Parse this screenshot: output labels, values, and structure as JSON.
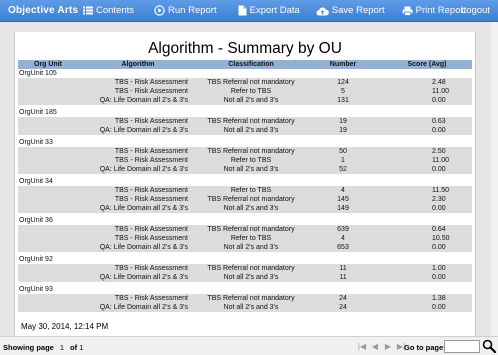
{
  "topbar": {
    "brand": "Objective Arts",
    "contents": "Contents",
    "run_report": "Run Report",
    "export_data": "Export Data",
    "save_report": "Save Report",
    "print_report": "Print Report",
    "logout": "Logout"
  },
  "report": {
    "title": "Algorithm - Summary by OU",
    "columns": [
      "Org Unit",
      "Algorithm",
      "Classification",
      "Number",
      "Score (Avg)"
    ],
    "groups": [
      {
        "org": "OrgUnit 105",
        "rows": [
          {
            "alg": "TBS - Risk Assessment",
            "cls": "TBS Referral not mandatory",
            "num": "124",
            "score": "2.48"
          },
          {
            "alg": "TBS - Risk Assessment",
            "cls": "Refer to TBS",
            "num": "5",
            "score": "11.00"
          },
          {
            "alg": "QA: Life Domain all 2's & 3's",
            "cls": "Not all 2's and 3's",
            "num": "131",
            "score": "0.00"
          }
        ]
      },
      {
        "org": "OrgUnit 185",
        "rows": [
          {
            "alg": "TBS - Risk Assessment",
            "cls": "TBS Referral not mandatory",
            "num": "19",
            "score": "0.63"
          },
          {
            "alg": "QA: Life Domain all 2's & 3's",
            "cls": "Not all 2's and 3's",
            "num": "19",
            "score": "0.00"
          }
        ]
      },
      {
        "org": "OrgUnit 33",
        "rows": [
          {
            "alg": "TBS - Risk Assessment",
            "cls": "TBS Referral not mandatory",
            "num": "50",
            "score": "2.50"
          },
          {
            "alg": "TBS - Risk Assessment",
            "cls": "Refer to TBS",
            "num": "1",
            "score": "11.00"
          },
          {
            "alg": "QA: Life Domain all 2's & 3's",
            "cls": "Not all 2's and 3's",
            "num": "52",
            "score": "0.00"
          }
        ]
      },
      {
        "org": "OrgUnit 34",
        "rows": [
          {
            "alg": "TBS - Risk Assessment",
            "cls": "Refer to TBS",
            "num": "4",
            "score": "11.50"
          },
          {
            "alg": "TBS - Risk Assessment",
            "cls": "TBS Referral not mandatory",
            "num": "145",
            "score": "2.30"
          },
          {
            "alg": "QA: Life Domain all 2's & 3's",
            "cls": "Not all 2's and 3's",
            "num": "149",
            "score": "0.00"
          }
        ]
      },
      {
        "org": "OrgUnit 36",
        "rows": [
          {
            "alg": "TBS - Risk Assessment",
            "cls": "TBS Referral not mandatory",
            "num": "639",
            "score": "0.64"
          },
          {
            "alg": "TBS - Risk Assessment",
            "cls": "Refer to TBS",
            "num": "4",
            "score": "10.50"
          },
          {
            "alg": "QA: Life Domain all 2's & 3's",
            "cls": "Not all 2's and 3's",
            "num": "653",
            "score": "0.00"
          }
        ]
      },
      {
        "org": "OrgUnit 92",
        "rows": [
          {
            "alg": "TBS - Risk Assessment",
            "cls": "TBS Referral not mandatory",
            "num": "11",
            "score": "1.00"
          },
          {
            "alg": "QA: Life Domain all 2's & 3's",
            "cls": "Not all 2's and 3's",
            "num": "11",
            "score": "0.00"
          }
        ]
      },
      {
        "org": "OrgUnit 93",
        "rows": [
          {
            "alg": "TBS - Risk Assessment",
            "cls": "TBS Referral not mandatory",
            "num": "24",
            "score": "1.38"
          },
          {
            "alg": "QA: Life Domain all 2's & 3's",
            "cls": "Not all 2's and 3's",
            "num": "24",
            "score": "0.00"
          }
        ]
      }
    ],
    "timestamp": "May 30, 2014, 12:14 PM"
  },
  "footer": {
    "showing_label": "Showing page",
    "current_page": "1",
    "of_label": "of",
    "total_pages": "1",
    "goto_label": "Go to page:",
    "goto_value": ""
  },
  "icons": {
    "contents": "list-icon",
    "run_report": "play-circle-icon",
    "export_data": "document-icon",
    "save_report": "cloud-upload-icon",
    "print_report": "printer-icon",
    "search": "magnifier-icon"
  },
  "colors": {
    "topbar": "#4a8ade",
    "table_header": "#93b2d3",
    "row_shade": "#dcdcdc"
  }
}
